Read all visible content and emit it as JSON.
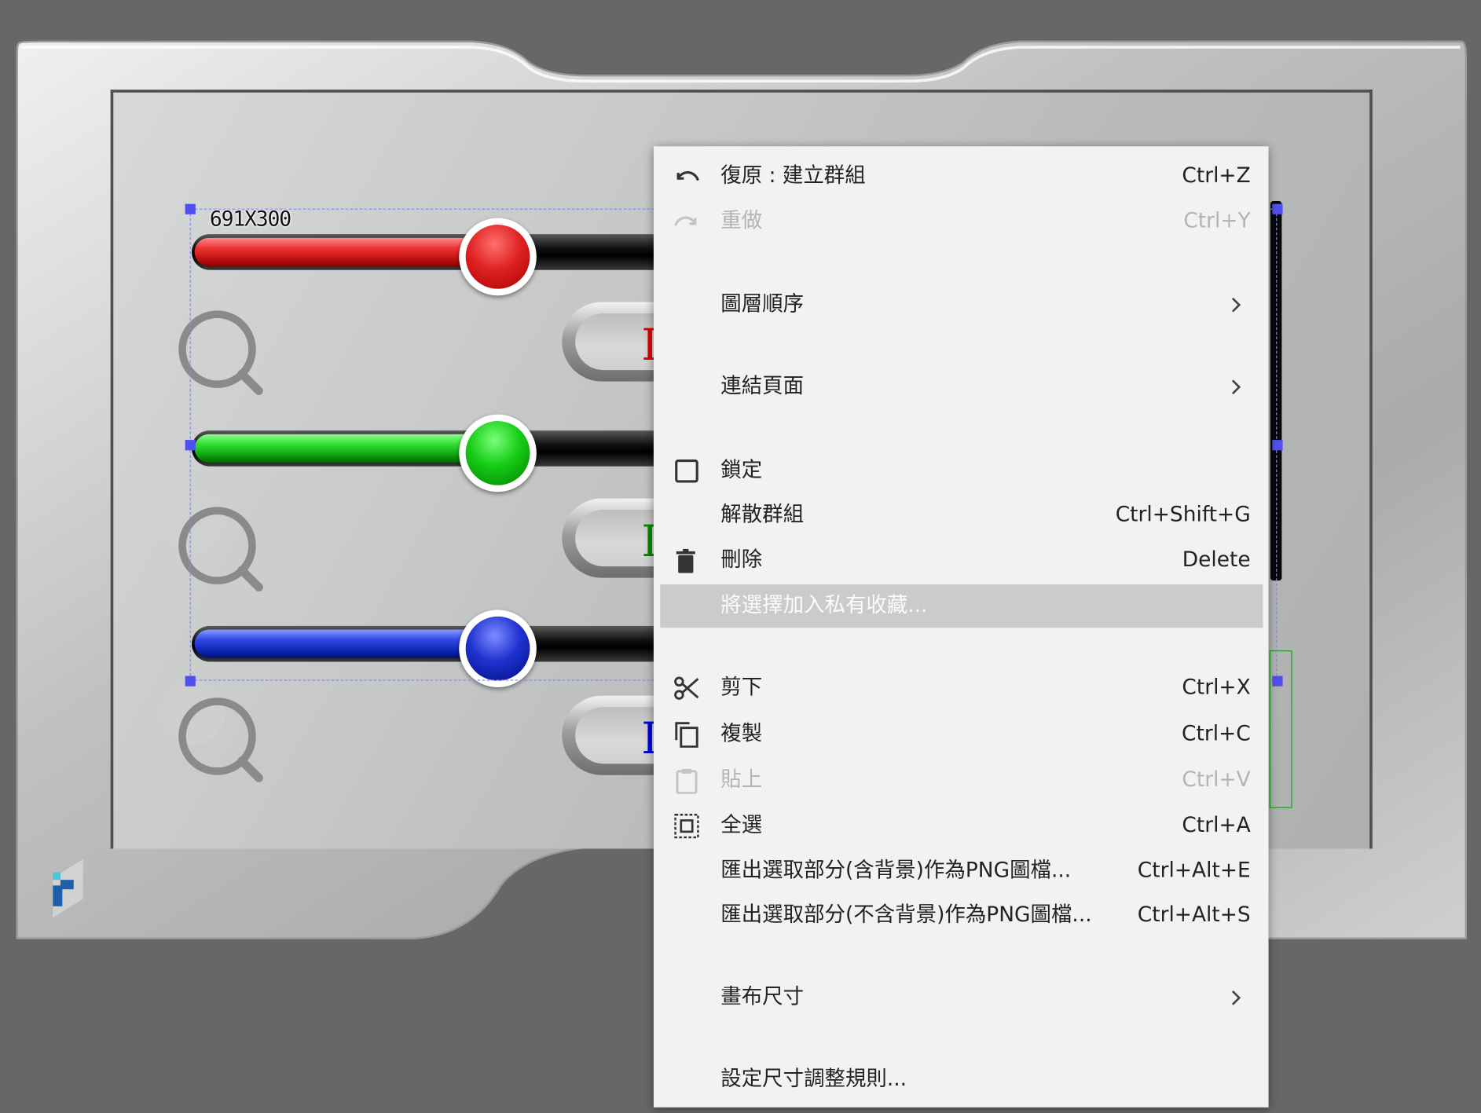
{
  "canvas": {
    "dimension_label": "691X300",
    "sliders": [
      {
        "name": "red",
        "value": 0.55,
        "color": "#e02222"
      },
      {
        "name": "green",
        "value": 0.55,
        "color": "#16cc16"
      },
      {
        "name": "blue",
        "value": 0.55,
        "color": "#1e32d0"
      }
    ],
    "pill_letters": [
      {
        "text": "I",
        "color": "#e00000"
      },
      {
        "text": "I",
        "color": "#008a00"
      },
      {
        "text": "I",
        "color": "#0000e0"
      }
    ],
    "icons": [
      "search-icon",
      "search-icon",
      "search-icon",
      "app-logo"
    ]
  },
  "context_menu": {
    "items": [
      {
        "label": "復原 : 建立群組",
        "shortcut": "Ctrl+Z",
        "icon": "undo-icon",
        "enabled": true
      },
      {
        "label": "重做",
        "shortcut": "Ctrl+Y",
        "icon": "redo-icon",
        "enabled": false
      },
      {
        "label": "圖層順序",
        "shortcut": "",
        "icon": "chevron-right-icon",
        "enabled": true
      },
      {
        "label": "連結頁面",
        "shortcut": "",
        "icon": "chevron-right-icon",
        "enabled": true
      },
      {
        "label": "鎖定",
        "shortcut": "",
        "icon": "checkbox-icon",
        "enabled": true
      },
      {
        "label": "解散群組",
        "shortcut": "Ctrl+Shift+G",
        "icon": "",
        "enabled": true
      },
      {
        "label": "刪除",
        "shortcut": "Delete",
        "icon": "trash-icon",
        "enabled": true
      },
      {
        "label": "將選擇加入私有收藏...",
        "shortcut": "",
        "icon": "",
        "enabled": true,
        "highlighted": true
      },
      {
        "label": "剪下",
        "shortcut": "Ctrl+X",
        "icon": "scissors-icon",
        "enabled": true
      },
      {
        "label": "複製",
        "shortcut": "Ctrl+C",
        "icon": "copy-icon",
        "enabled": true
      },
      {
        "label": "貼上",
        "shortcut": "Ctrl+V",
        "icon": "clipboard-icon",
        "enabled": false
      },
      {
        "label": "全選",
        "shortcut": "Ctrl+A",
        "icon": "select-all-icon",
        "enabled": true
      },
      {
        "label": "匯出選取部分(含背景)作為PNG圖檔...",
        "shortcut": "Ctrl+Alt+E",
        "icon": "",
        "enabled": true
      },
      {
        "label": "匯出選取部分(不含背景)作為PNG圖檔...",
        "shortcut": "Ctrl+Alt+S",
        "icon": "",
        "enabled": true
      },
      {
        "label": "畫布尺寸",
        "shortcut": "",
        "icon": "chevron-right-icon",
        "enabled": true
      },
      {
        "label": "設定尺寸調整規則...",
        "shortcut": "",
        "icon": "",
        "enabled": true
      }
    ]
  }
}
